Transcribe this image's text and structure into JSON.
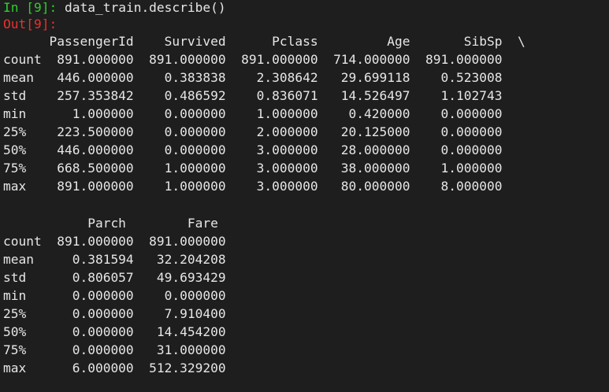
{
  "cell": {
    "in_prompt": "In [9]:",
    "code": "data_train.describe()",
    "out_prompt": "Out[9]:"
  },
  "output": {
    "blocks": [
      {
        "header": "      PassengerId    Survived      Pclass         Age       SibSp  \\",
        "rows": [
          "count  891.000000  891.000000  891.000000  714.000000  891.000000",
          "mean   446.000000    0.383838    2.308642   29.699118    0.523008",
          "std    257.353842    0.486592    0.836071   14.526497    1.102743",
          "min      1.000000    0.000000    1.000000    0.420000    0.000000",
          "25%    223.500000    0.000000    2.000000   20.125000    0.000000",
          "50%    446.000000    0.000000    3.000000   28.000000    0.000000",
          "75%    668.500000    1.000000    3.000000   38.000000    1.000000",
          "max    891.000000    1.000000    3.000000   80.000000    8.000000"
        ]
      },
      {
        "header": "           Parch        Fare",
        "rows": [
          "count  891.000000  891.000000",
          "mean     0.381594   32.204208",
          "std      0.806057   49.693429",
          "min      0.000000    0.000000",
          "25%      0.000000    7.910400",
          "50%      0.000000   14.454200",
          "75%      0.000000   31.000000",
          "max      6.000000  512.329200"
        ]
      }
    ]
  }
}
